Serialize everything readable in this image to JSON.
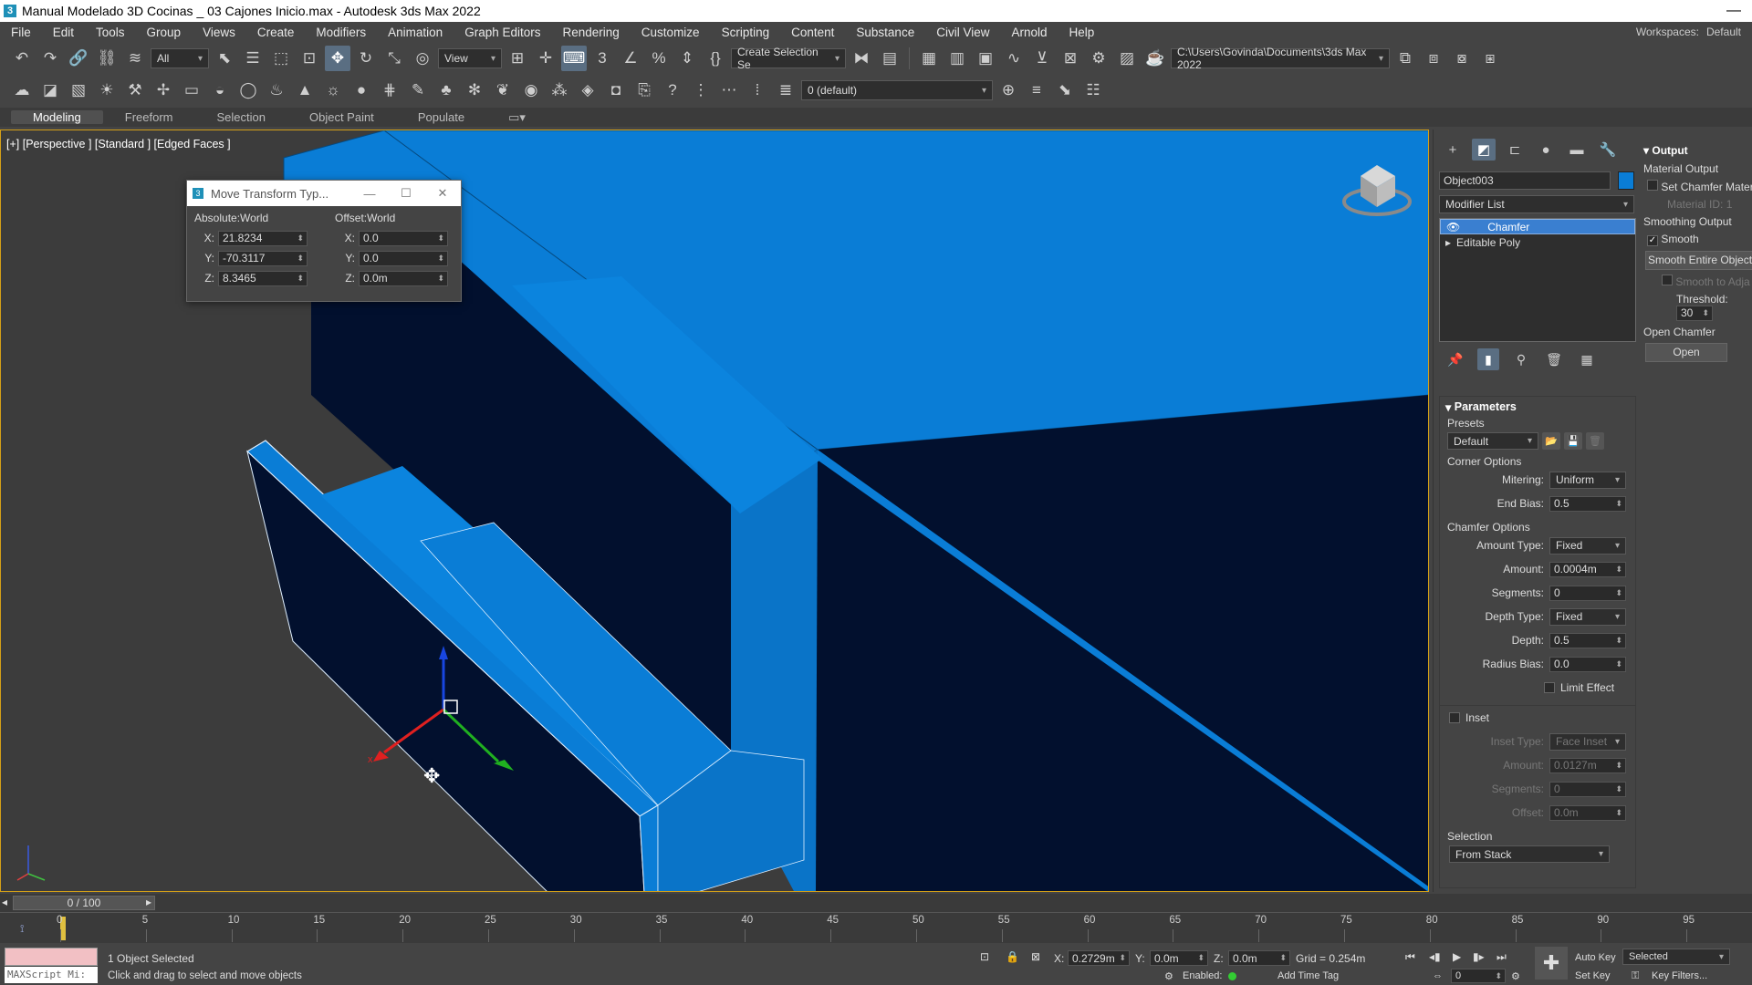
{
  "window": {
    "title": "Manual Modelado 3D Cocinas _ 03 Cajones Inicio.max - Autodesk 3ds Max 2022",
    "minimize": "—"
  },
  "menu": {
    "items": [
      "File",
      "Edit",
      "Tools",
      "Group",
      "Views",
      "Create",
      "Modifiers",
      "Animation",
      "Graph Editors",
      "Rendering",
      "Customize",
      "Scripting",
      "Content",
      "Substance",
      "Civil View",
      "Arnold",
      "Help"
    ],
    "workspaces_label": "Workspaces:",
    "workspaces_value": "Default"
  },
  "toolbar": {
    "filter": "All",
    "ref_coord": "View",
    "selection_set": "Create Selection Se",
    "project_path": "C:\\Users\\Govinda\\Documents\\3ds Max 2022",
    "layer": "0 (default)"
  },
  "ribbon": {
    "tabs": [
      "Modeling",
      "Freeform",
      "Selection",
      "Object Paint",
      "Populate"
    ]
  },
  "viewport": {
    "label": "[+] [Perspective ] [Standard ] [Edged Faces ]"
  },
  "move_dialog": {
    "title": "Move Transform Typ...",
    "absolute_label": "Absolute:World",
    "offset_label": "Offset:World",
    "abs": {
      "x": "21.8234",
      "y": "-70.3117",
      "z": "8.3465"
    },
    "off": {
      "x": "0.0",
      "y": "0.0",
      "z": "0.0m"
    },
    "axis_x": "X:",
    "axis_y": "Y:",
    "axis_z": "Z:"
  },
  "command_panel": {
    "object_name": "Object003",
    "object_color": "#0a7dd6",
    "modifier_list": "Modifier List",
    "stack": [
      "Chamfer",
      "Editable Poly"
    ],
    "parameters": {
      "header": "Parameters",
      "presets_label": "Presets",
      "presets_value": "Default",
      "corner_options": "Corner Options",
      "mitering_label": "Mitering:",
      "mitering_value": "Uniform",
      "end_bias_label": "End Bias:",
      "end_bias_value": "0.5",
      "chamfer_options": "Chamfer Options",
      "amount_type_label": "Amount Type:",
      "amount_type_value": "Fixed",
      "amount_label": "Amount:",
      "amount_value": "0.0004m",
      "segments_label": "Segments:",
      "segments_value": "0",
      "depth_type_label": "Depth Type:",
      "depth_type_value": "Fixed",
      "depth_label": "Depth:",
      "depth_value": "0.5",
      "radius_bias_label": "Radius Bias:",
      "radius_bias_value": "0.0",
      "limit_effect": "Limit Effect",
      "inset": "Inset",
      "inset_type_label": "Inset Type:",
      "inset_type_value": "Face Inset",
      "inset_amount_label": "Amount:",
      "inset_amount_value": "0.0127m",
      "inset_segments_label": "Segments:",
      "inset_segments_value": "0",
      "offset_label": "Offset:",
      "offset_value": "0.0m",
      "selection": "Selection",
      "selection_value": "From Stack"
    },
    "output": {
      "header": "Output",
      "material_output": "Material Output",
      "set_chamfer": "Set Chamfer Mater",
      "material_id_label": "Material ID:",
      "material_id_value": "1",
      "smoothing_output": "Smoothing Output",
      "smooth": "Smooth",
      "smooth_entire": "Smooth Entire Object",
      "smooth_adjacent": "Smooth to Adja",
      "threshold_label": "Threshold:",
      "threshold_value": "30",
      "open_chamfer": "Open Chamfer",
      "open_btn": "Open"
    }
  },
  "timeline": {
    "frame": "0 / 100",
    "ticks": [
      "0",
      "5",
      "10",
      "15",
      "20",
      "25",
      "30",
      "35",
      "40",
      "45",
      "50",
      "55",
      "60",
      "65",
      "70",
      "75",
      "80",
      "85",
      "90",
      "95"
    ]
  },
  "status": {
    "selected": "1 Object Selected",
    "hint": "Click and drag to select and move objects",
    "maxscript": "MAXScript Mi:",
    "x_label": "X:",
    "x_value": "0.2729m",
    "y_label": "Y:",
    "y_value": "0.0m",
    "z_label": "Z:",
    "z_value": "0.0m",
    "grid": "Grid = 0.254m",
    "enabled": "Enabled:",
    "add_time_tag": "Add Time Tag",
    "auto_key": "Auto Key",
    "key_mode": "Selected",
    "set_key": "Set Key",
    "key_filters": "Key Filters...",
    "current_frame": "0"
  }
}
